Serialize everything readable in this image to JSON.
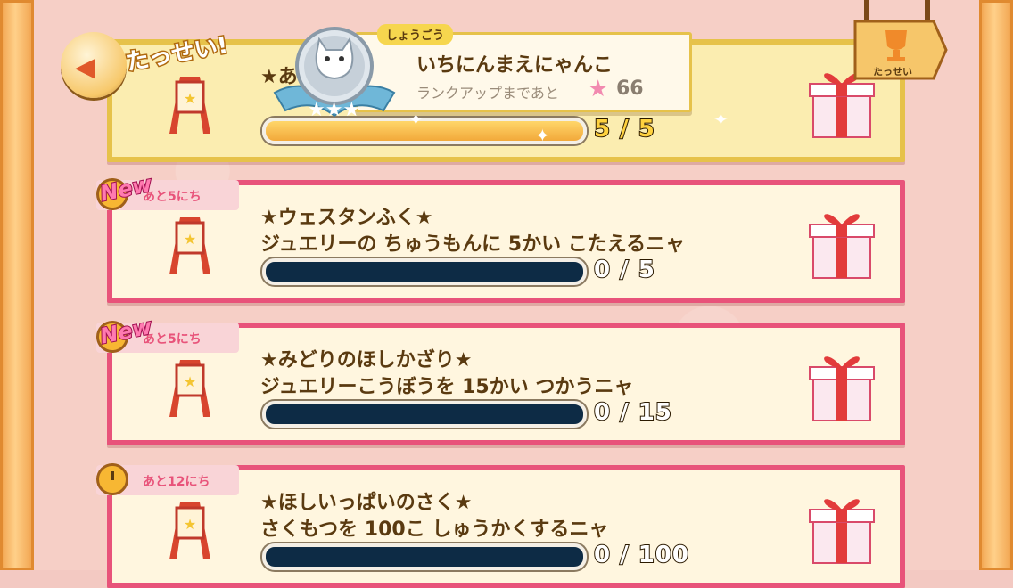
{
  "top": {
    "back_label": "",
    "complete_stamp": "たっせい!",
    "achievement_button_label": "たっせい"
  },
  "popup": {
    "tag": "しょうごう",
    "title": "いちにんまえにゃんこ",
    "rank_text": "ランクアップまであと",
    "rank_remaining": "66",
    "star_icon": "star-icon"
  },
  "missions": [
    {
      "status": "completed",
      "title": "★あ",
      "description": "",
      "progress_text": "5 / 5",
      "progress": 1.0
    },
    {
      "status": "new",
      "badge": "New",
      "deadline": "あと5にち",
      "title": "★ウェスタンふく★",
      "description": "ジュエリーの ちゅうもんに 5かい こたえるニャ",
      "progress_text": "0 / 5",
      "progress": 0.0
    },
    {
      "status": "new",
      "badge": "New",
      "deadline": "あと5にち",
      "title": "★みどりのほしかざり★",
      "description": "ジュエリーこうぼうを 15かい つかうニャ",
      "progress_text": "0 / 15",
      "progress": 0.0
    },
    {
      "status": "active",
      "deadline": "あと12にち",
      "title": "★ほしいっぱいのさく★",
      "description": "さくもつを 100こ しゅうかくするニャ",
      "progress_text": "0 / 100",
      "progress": 0.0
    }
  ],
  "colors": {
    "card_border_active": "#e8537a",
    "card_border_done": "#e6c24a",
    "progress_empty": "#0d2b45",
    "progress_full": "#f2a93a",
    "text_brown": "#5a3a10"
  }
}
